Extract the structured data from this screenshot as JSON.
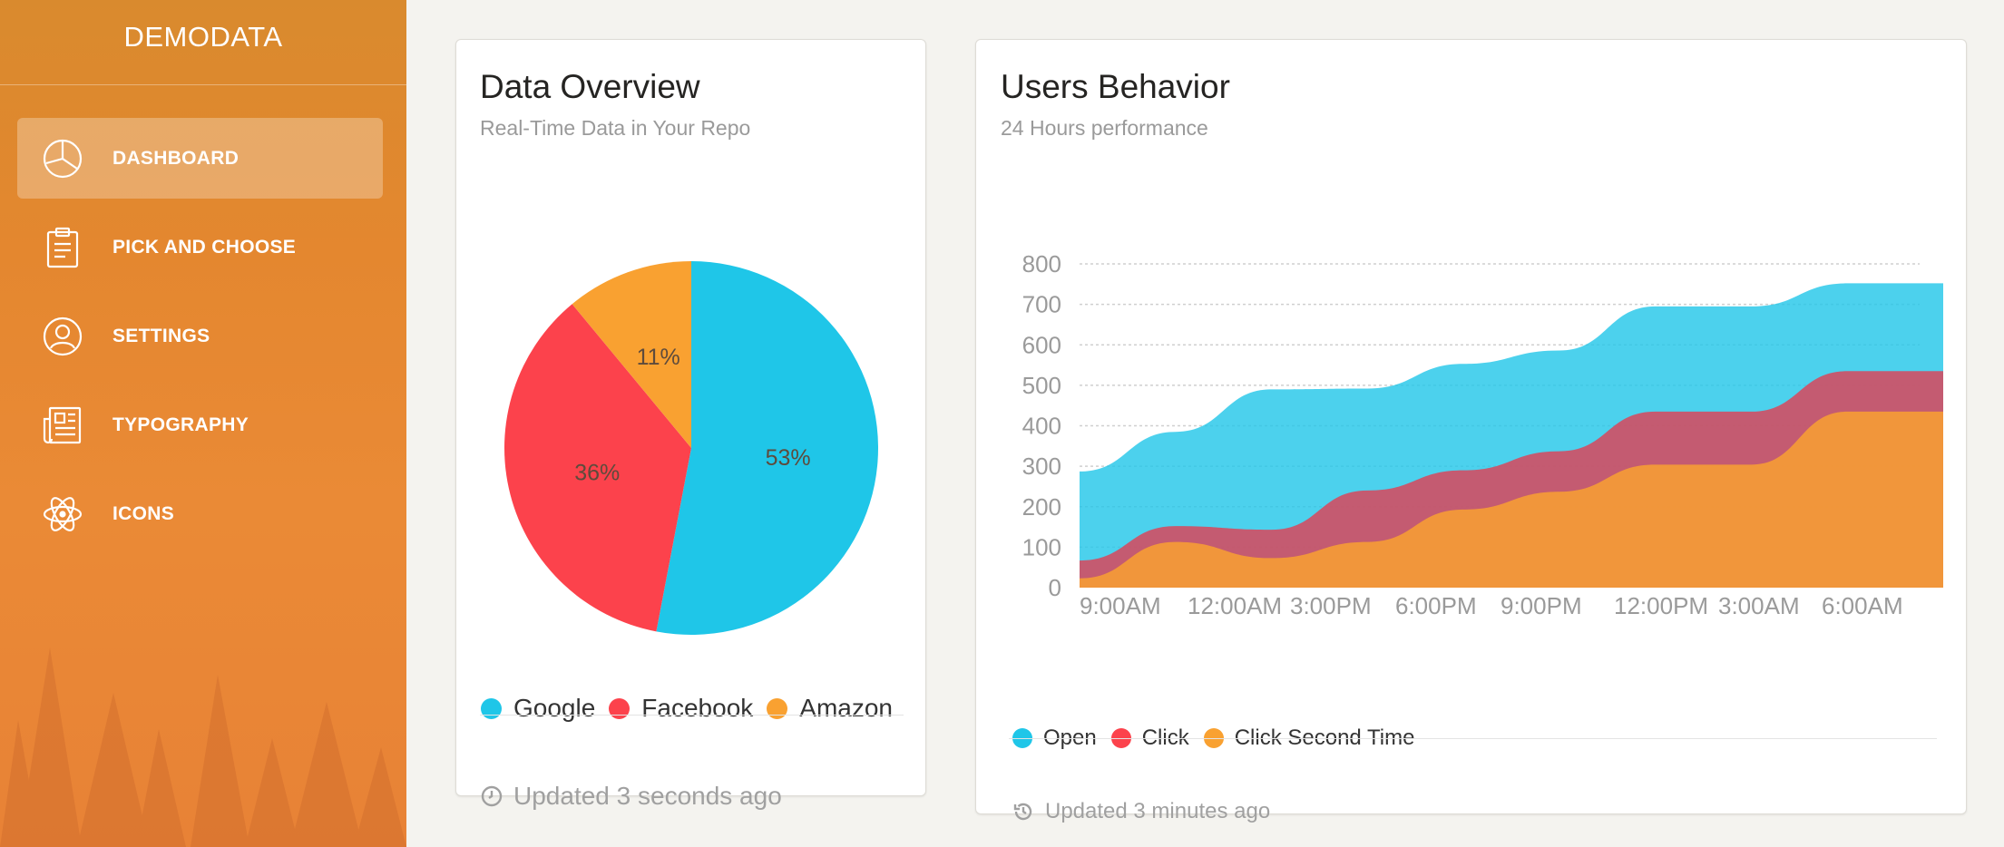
{
  "sidebar": {
    "brand": "DEMODATA",
    "items": [
      {
        "label": "DASHBOARD",
        "icon": "pie-chart-icon"
      },
      {
        "label": "PICK AND CHOOSE",
        "icon": "clipboard-icon"
      },
      {
        "label": "SETTINGS",
        "icon": "user-icon"
      },
      {
        "label": "TYPOGRAPHY",
        "icon": "newspaper-icon"
      },
      {
        "label": "ICONS",
        "icon": "atom-icon"
      }
    ]
  },
  "overview": {
    "title": "Data Overview",
    "subtitle": "Real-Time Data in Your Repo",
    "footer": "Updated 3 seconds ago",
    "footer_icon": "clock-icon"
  },
  "behavior": {
    "title": "Users Behavior",
    "subtitle": "24 Hours performance",
    "footer": "Updated 3 minutes ago",
    "footer_icon": "history-icon"
  },
  "colors": {
    "google": "#1fc6e8",
    "facebook": "#fc424c",
    "amazon": "#f9a131"
  },
  "chart_data": [
    {
      "type": "pie",
      "title": "",
      "labels": [
        "Google",
        "Facebook",
        "Amazon"
      ],
      "values": [
        53,
        36,
        11
      ],
      "value_labels": [
        "53%",
        "36%",
        "11%"
      ],
      "colors": [
        "#1fc6e8",
        "#fc424c",
        "#f9a131"
      ],
      "legend": "bottom"
    },
    {
      "type": "area",
      "title": "",
      "categories": [
        "9:00AM",
        "12:00AM",
        "3:00PM",
        "6:00PM",
        "9:00PM",
        "12:00PM",
        "3:00AM",
        "6:00AM"
      ],
      "ylim": [
        0,
        800
      ],
      "yticks": [
        0,
        100,
        200,
        300,
        400,
        500,
        600,
        700,
        800
      ],
      "grid": true,
      "legend": "bottom-left",
      "series": [
        {
          "name": "Open",
          "color": "#1fc6e8",
          "values": [
            287,
            385,
            490,
            492,
            553,
            586,
            695,
            695,
            752,
            752
          ]
        },
        {
          "name": "Click",
          "color": "#d9475a",
          "values": [
            67,
            152,
            143,
            240,
            290,
            337,
            435,
            435,
            535,
            535
          ]
        },
        {
          "name": "Click Second Time",
          "color": "#f9a131",
          "values": [
            23,
            113,
            73,
            113,
            193,
            237,
            304,
            304,
            435,
            435
          ]
        }
      ]
    }
  ]
}
